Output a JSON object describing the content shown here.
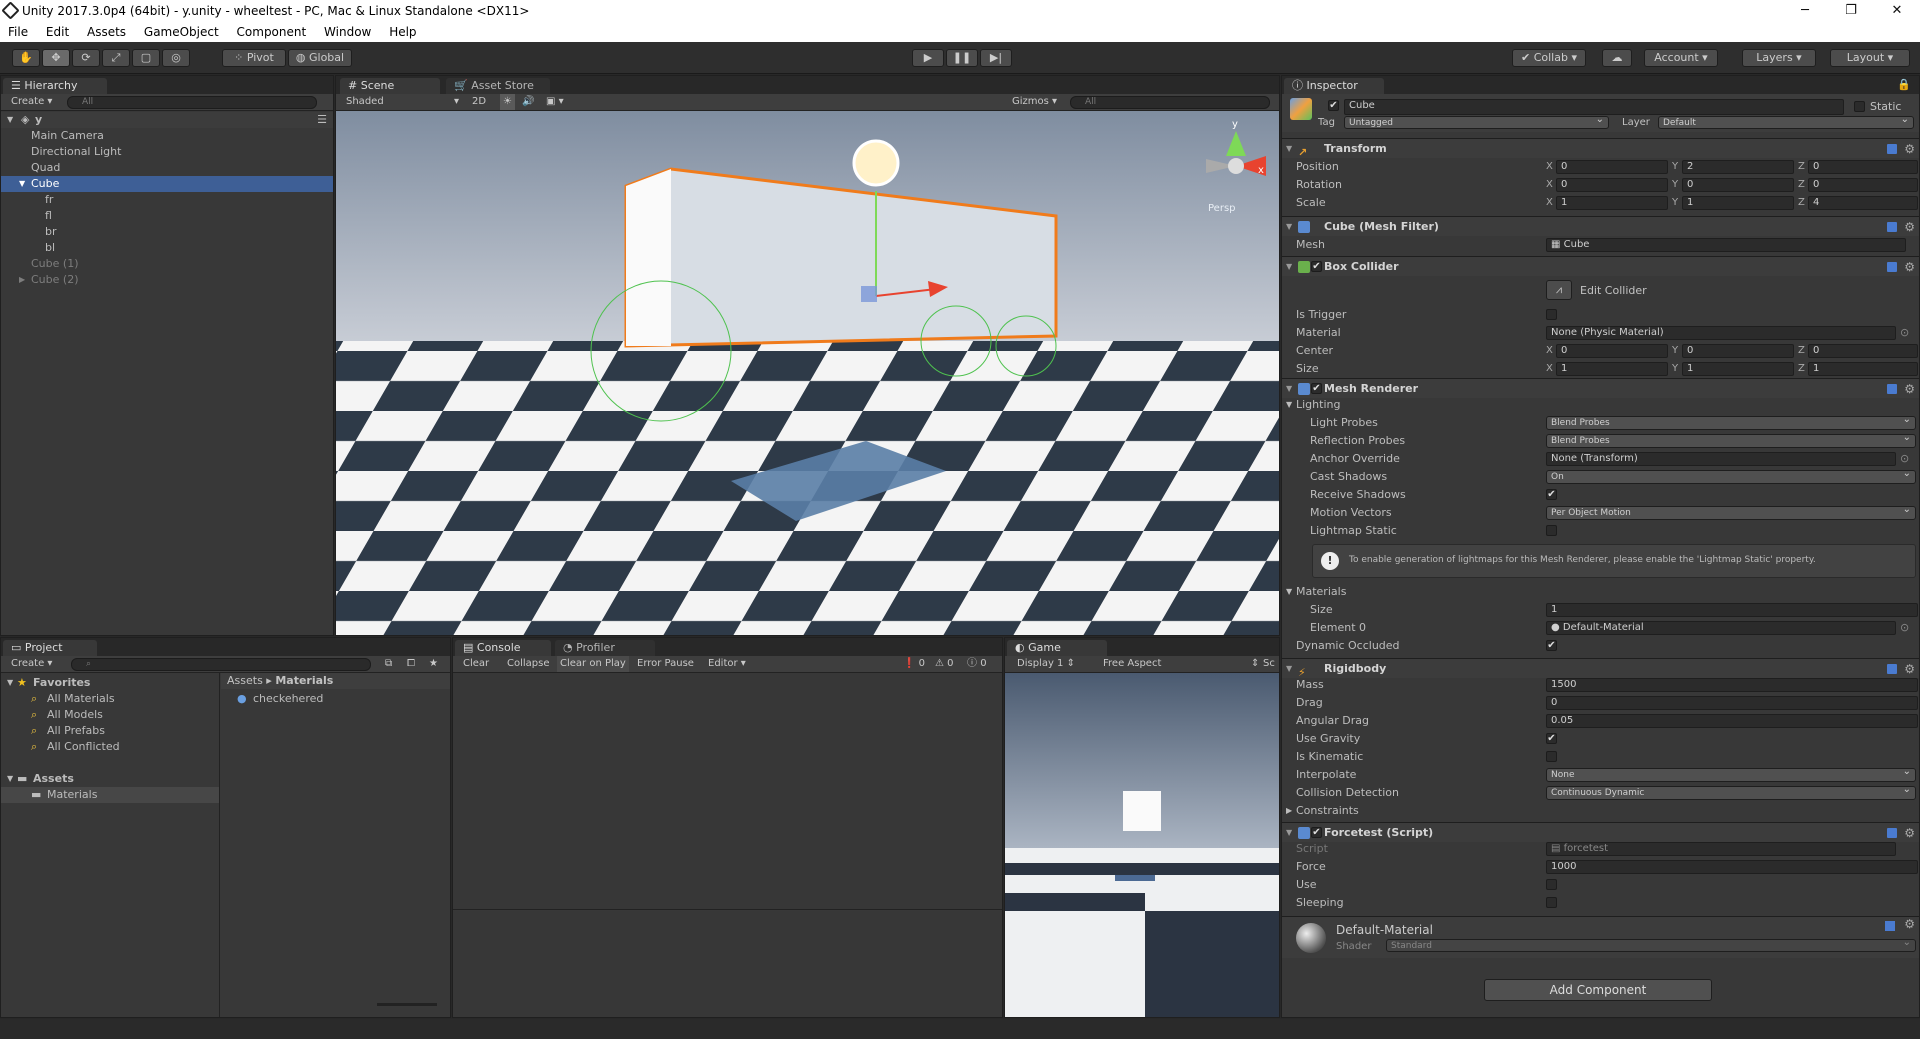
{
  "window": {
    "title": "Unity 2017.3.0p4 (64bit) - y.unity - wheeltest - PC, Mac & Linux Standalone <DX11>",
    "min": "─",
    "max": "❐",
    "close": "✕"
  },
  "menu": [
    "File",
    "Edit",
    "Assets",
    "GameObject",
    "Component",
    "Window",
    "Help"
  ],
  "toolbar": {
    "pivot": "Pivot",
    "global": "Global",
    "collab": "Collab",
    "account": "Account",
    "layers": "Layers",
    "layout": "Layout"
  },
  "hierarchy": {
    "tab": "Hierarchy",
    "create": "Create",
    "search_placeholder": "All",
    "scene": "y",
    "items": [
      {
        "label": "Main Camera",
        "level": 1
      },
      {
        "label": "Directional Light",
        "level": 1
      },
      {
        "label": "Quad",
        "level": 1
      },
      {
        "label": "Cube",
        "level": 1,
        "selected": true
      },
      {
        "label": "fr",
        "level": 2
      },
      {
        "label": "fl",
        "level": 2
      },
      {
        "label": "br",
        "level": 2
      },
      {
        "label": "bl",
        "level": 2
      },
      {
        "label": "Cube (1)",
        "level": 1,
        "dim": true
      },
      {
        "label": "Cube (2)",
        "level": 1,
        "dim": true
      }
    ]
  },
  "scene": {
    "tab": "Scene",
    "asset_store_tab": "Asset Store",
    "shading": "Shaded",
    "mode_2d": "2D",
    "gizmos": "Gizmos",
    "search_placeholder": "All",
    "persp": "Persp",
    "axis_x": "x",
    "axis_y": "y"
  },
  "project": {
    "tab": "Project",
    "create": "Create",
    "favorites_label": "Favorites",
    "favorites": [
      "All Materials",
      "All Models",
      "All Prefabs",
      "All Conflicted"
    ],
    "assets_label": "Assets",
    "folders": [
      "Materials"
    ],
    "breadcrumb_root": "Assets",
    "breadcrumb_leaf": "Materials",
    "files": [
      "checkehered"
    ]
  },
  "console": {
    "tab": "Console",
    "profiler_tab": "Profiler",
    "buttons": [
      "Clear",
      "Collapse",
      "Clear on Play",
      "Error Pause",
      "Editor"
    ],
    "counts": {
      "errors": "0",
      "warnings": "0",
      "logs": "0"
    }
  },
  "game": {
    "tab": "Game",
    "display": "Display 1",
    "aspect": "Free Aspect",
    "scale": "Sc"
  },
  "inspector": {
    "tab": "Inspector",
    "name": "Cube",
    "static": "Static",
    "tag_label": "Tag",
    "tag": "Untagged",
    "layer_label": "Layer",
    "layer": "Default",
    "transform": {
      "title": "Transform",
      "rows": [
        {
          "label": "Position",
          "x": "0",
          "y": "2",
          "z": "0"
        },
        {
          "label": "Rotation",
          "x": "0",
          "y": "0",
          "z": "0"
        },
        {
          "label": "Scale",
          "x": "1",
          "y": "1",
          "z": "4"
        }
      ]
    },
    "mesh_filter": {
      "title": "Cube (Mesh Filter)",
      "mesh_label": "Mesh",
      "mesh": "Cube"
    },
    "box_collider": {
      "title": "Box Collider",
      "edit": "Edit Collider",
      "is_trigger": "Is Trigger",
      "material_label": "Material",
      "material": "None (Physic Material)",
      "center_label": "Center",
      "center": {
        "x": "0",
        "y": "0",
        "z": "0"
      },
      "size_label": "Size",
      "size": {
        "x": "1",
        "y": "1",
        "z": "1"
      }
    },
    "mesh_renderer": {
      "title": "Mesh Renderer",
      "lighting": "Lighting",
      "light_probes_label": "Light Probes",
      "light_probes": "Blend Probes",
      "reflection_probes_label": "Reflection Probes",
      "reflection_probes": "Blend Probes",
      "anchor_label": "Anchor Override",
      "anchor": "None (Transform)",
      "cast_label": "Cast Shadows",
      "cast": "On",
      "receive_label": "Receive Shadows",
      "motion_label": "Motion Vectors",
      "motion": "Per Object Motion",
      "lightmap_label": "Lightmap Static",
      "info": "To enable generation of lightmaps for this Mesh Renderer, please enable the 'Lightmap Static' property.",
      "materials_label": "Materials",
      "size_label": "Size",
      "size": "1",
      "element_label": "Element 0",
      "element": "Default-Material",
      "dyn_label": "Dynamic Occluded"
    },
    "rigidbody": {
      "title": "Rigidbody",
      "mass_label": "Mass",
      "mass": "1500",
      "drag_label": "Drag",
      "drag": "0",
      "angular_label": "Angular Drag",
      "angular": "0.05",
      "gravity_label": "Use Gravity",
      "kinematic_label": "Is Kinematic",
      "interpolate_label": "Interpolate",
      "interpolate": "None",
      "collision_label": "Collision Detection",
      "collision": "Continuous Dynamic",
      "constraints_label": "Constraints"
    },
    "script": {
      "title": "Forcetest (Script)",
      "script_label": "Script",
      "script": "forcetest",
      "force_label": "Force",
      "force": "1000",
      "use_label": "Use",
      "sleeping_label": "Sleeping"
    },
    "material": {
      "name": "Default-Material",
      "shader_label": "Shader",
      "shader": "Standard"
    },
    "add_component": "Add Component"
  },
  "colors": {
    "accent": "#3e5f96",
    "outline": "#f07b1b",
    "sky": "#a9b3c2"
  }
}
